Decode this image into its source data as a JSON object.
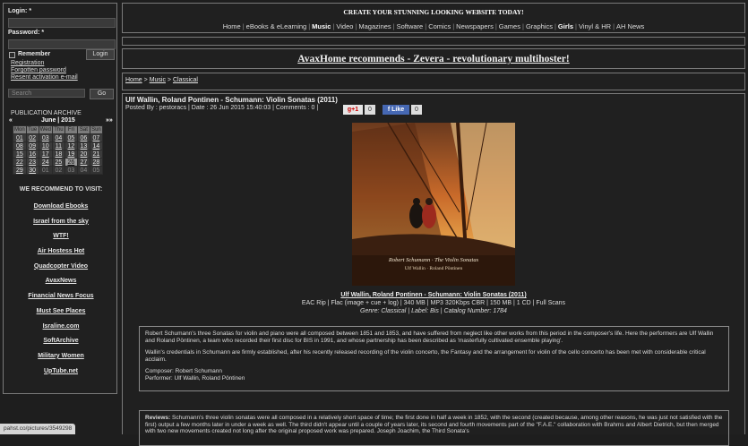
{
  "sidebar": {
    "login_label": "Login: *",
    "password_label": "Password: *",
    "remember_label": "Remember",
    "login_button": "Login",
    "links": [
      "Registration",
      "Forgotten password",
      "Resent activation e-mail"
    ],
    "search_placeholder": "Search",
    "search_button": "Go",
    "archive_title": "PUBLICATION ARCHIVE",
    "calendar_prev": "«",
    "calendar_month": "June | 2015",
    "calendar_next": "»»",
    "calendar_headers": [
      "Mon",
      "Tue",
      "Wed",
      "Thu",
      "Fri",
      "Sat",
      "Sun"
    ],
    "calendar_rows": [
      [
        "01",
        "02",
        "03",
        "04",
        "05",
        "06",
        "07"
      ],
      [
        "08",
        "09",
        "10",
        "11",
        "12",
        "13",
        "14"
      ],
      [
        "15",
        "16",
        "17",
        "18",
        "19",
        "20",
        "21"
      ],
      [
        "22",
        "23",
        "24",
        "25",
        "26",
        "27",
        "28"
      ],
      [
        "29",
        "30",
        "01",
        "02",
        "03",
        "04",
        "05"
      ]
    ],
    "calendar_today": "26",
    "recommend_title": "WE RECOMMEND TO VISIT:",
    "recommend": [
      "Download Ebooks",
      "Israel from the sky",
      "WTF!",
      "Air Hostess Hot",
      "Quadcopter Video",
      "AvaxNews",
      "Financial News Focus",
      "Must See Places",
      "Israline.com",
      "SoftArchive",
      "Military Women",
      "UpTube.net"
    ]
  },
  "header": {
    "banner": "CREATE YOUR STUNNING LOOKING WEBSITE TODAY!",
    "nav": [
      {
        "label": "Home",
        "bold": false
      },
      {
        "label": "eBooks & eLearning",
        "bold": false
      },
      {
        "label": "Music",
        "bold": true
      },
      {
        "label": "Video",
        "bold": false
      },
      {
        "label": "Magazines",
        "bold": false
      },
      {
        "label": "Software",
        "bold": false
      },
      {
        "label": "Comics",
        "bold": false
      },
      {
        "label": "Newspapers",
        "bold": false
      },
      {
        "label": "Games",
        "bold": false
      },
      {
        "label": "Graphics",
        "bold": false
      },
      {
        "label": "Girls",
        "bold": true
      },
      {
        "label": "Vinyl & HR",
        "bold": false
      },
      {
        "label": "AH News",
        "bold": false
      }
    ]
  },
  "promo": {
    "text": "AvaxHome recommends - Zevera - revolutionary multihoster!"
  },
  "breadcrumb": {
    "home": "Home",
    "music": "Music",
    "category": "Classical",
    "sep": ">",
    "cat_sep": "> "
  },
  "article": {
    "title": "Ulf Wallin, Roland Pontinen - Schumann: Violin Sonatas (2011)",
    "meta": "Posted By : pestoracs | Date : 26 Jun 2015 15:40:03 | Comments : 0 |",
    "gplus": "g+1",
    "gplus_count": "0",
    "fb_like": "f Like",
    "fb_count": "0",
    "cover": {
      "composer": "Robert Schumann · The Violin Sonatas",
      "performers": "Ulf Wallin · Roland Pöntinen"
    },
    "release_title": "Ulf Wallin, Roland Pontinen - Schumann: Violin Sonatas (2011)",
    "release_format": "EAC Rip | Flac (image + cue + log) | 340 MB | MP3 320Kbps CBR | 150 MB | 1 CD | Full Scans",
    "release_genre": "Genre: Classical | Label: Bis | Catalog Number: 1784",
    "desc_p1": "Robert Schumann's three Sonatas for violin and piano were all composed between 1851 and 1853, and have suffered from neglect like other works from this period in the composer's life. Here the performers are Ulf Wallin and Roland Pöntinen, a team who recorded their first disc for BIS in 1991, and whose partnership has been described as 'masterfully cultivated ensemble playing'.",
    "desc_p2": "Wallin's credentials in Schumann are firmly established, after his recently released recording of the violin concerto, the Fantasy and the arrangement for violin of the cello concerto has been met with considerable critical acclaim.",
    "composer_line": "Composer: Robert Schumann",
    "performer_line": "Performer: Ulf Wallin, Roland Pöntinen",
    "review_label": "Reviews:",
    "review_text": " Schumann's three violin sonatas were all composed in a relatively short space of time; the first done in half a week in 1852, with the second (created because, among other reasons, he was just not satisfied with the first) output a few months later in under a week as well. The third didn't appear until a couple of years later, its second and fourth movements part of the \"F.A.E.\" collaboration with Brahms and Albert Dietrich, but then merged with two new movements created not long after the original proposed work was prepared. Joseph Joachim, the Third Sonata's"
  },
  "status_bar": "pahst.co/pictures/3549298"
}
